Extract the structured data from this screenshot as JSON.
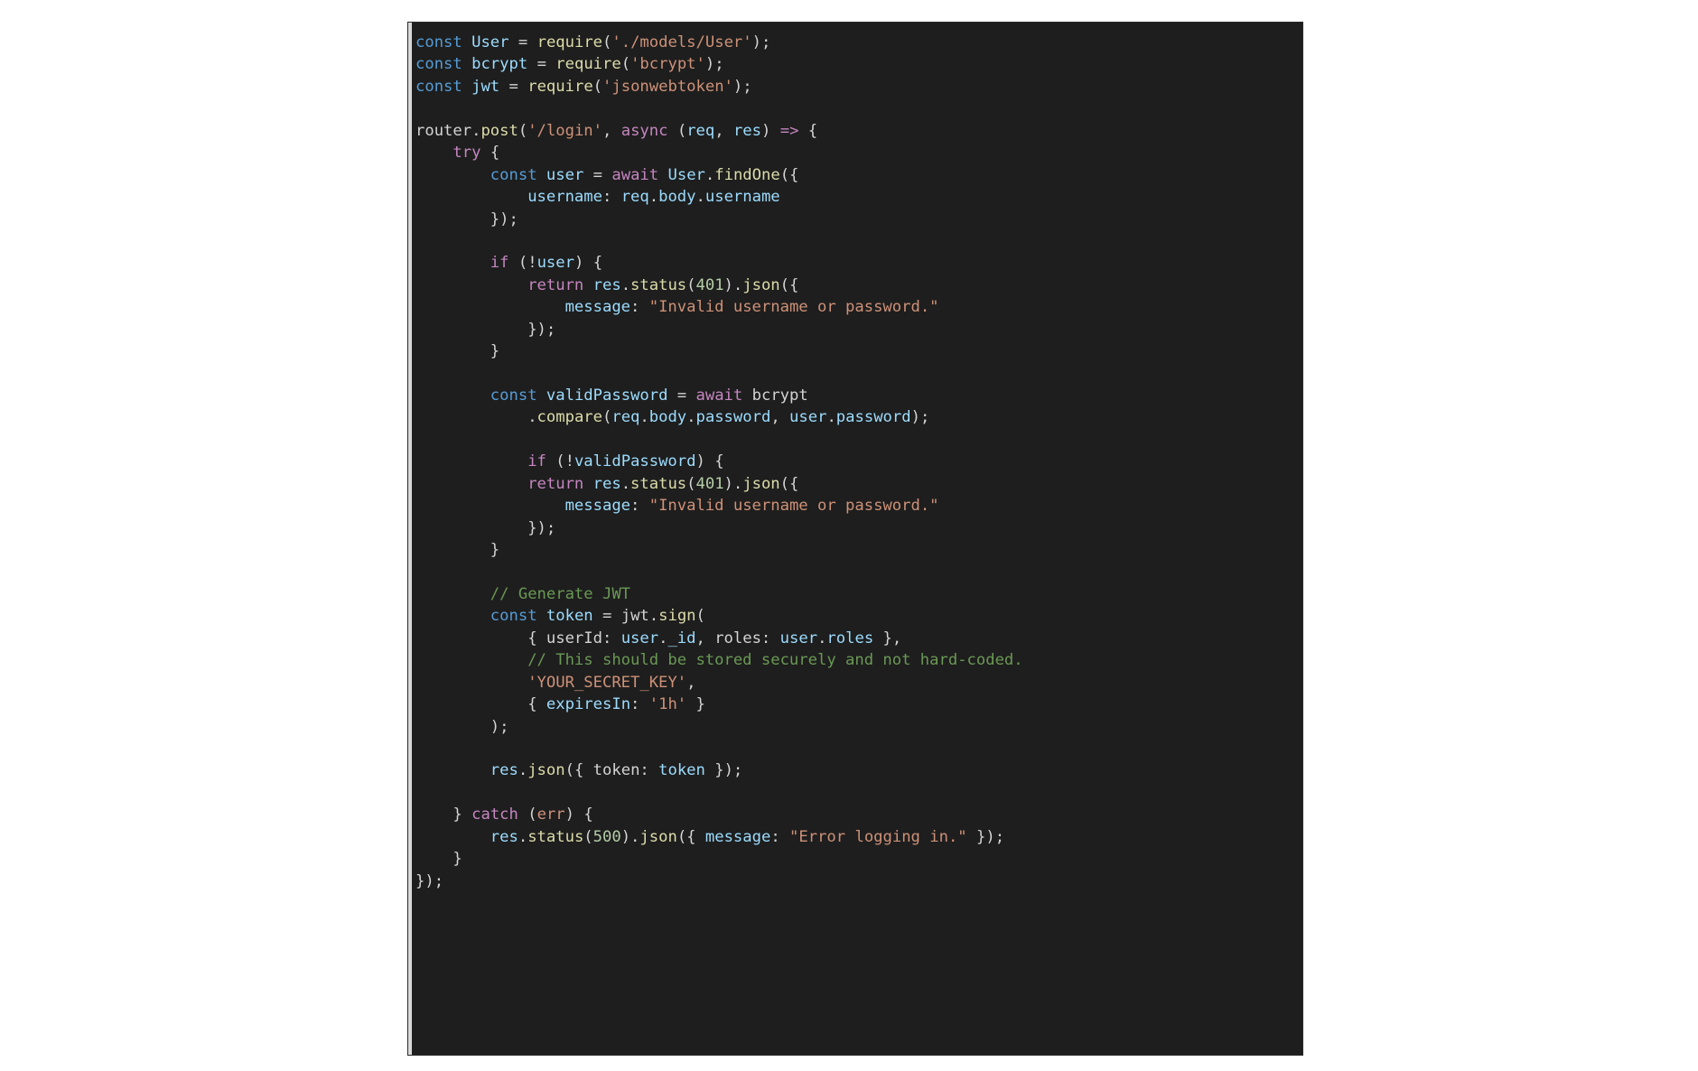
{
  "page": {
    "background_color": "#ffffff",
    "code_block_background": "#1e1e1e",
    "gutter_color": "#d9d9d9"
  },
  "theme": {
    "name": "dark-plus",
    "colors": {
      "keyword": "#569cd6",
      "control": "#c586c0",
      "variable": "#9cdcfe",
      "function": "#dcdcaa",
      "string": "#ce9178",
      "number": "#b5cea8",
      "comment": "#6a9955",
      "class": "#4ec9b0",
      "plain": "#d4d4d4"
    }
  },
  "code": {
    "language": "javascript",
    "line_count": 47,
    "plain_text": "const User = require('./models/User');\nconst bcrypt = require('bcrypt');\nconst jwt = require('jsonwebtoken');\n\nrouter.post('/login', async (req, res) => {\n    try {\n        const user = await User.findOne({\n            username: req.body.username\n        });\n\n        if (!user) {\n            return res.status(401).json({\n                message: \"Invalid username or password.\"\n            });\n        }\n\n        const validPassword = await bcrypt\n            .compare(req.body.password, user.password);\n\n            if (!validPassword) {\n            return res.status(401).json({\n                message: \"Invalid username or password.\"\n            });\n        }\n\n        // Generate JWT\n        const token = jwt.sign(\n            { userId: user._id, roles: user.roles },\n            // This should be stored securely and not hard-coded.\n            'YOUR_SECRET_KEY',\n            { expiresIn: '1h' }\n        );\n\n        res.json({ token: token });\n\n    } catch (err) {\n        res.status(500).json({ message: \"Error logging in.\" });\n    }\n});",
    "lines": [
      "const User = require('./models/User');",
      "const bcrypt = require('bcrypt');",
      "const jwt = require('jsonwebtoken');",
      "",
      "router.post('/login', async (req, res) => {",
      "    try {",
      "        const user = await User.findOne({",
      "            username: req.body.username",
      "        });",
      "",
      "        if (!user) {",
      "            return res.status(401).json({",
      "                message: \"Invalid username or password.\"",
      "            });",
      "        }",
      "",
      "        const validPassword = await bcrypt",
      "            .compare(req.body.password, user.password);",
      "",
      "            if (!validPassword) {",
      "            return res.status(401).json({",
      "                message: \"Invalid username or password.\"",
      "            });",
      "        }",
      "",
      "        // Generate JWT",
      "        const token = jwt.sign(",
      "            { userId: user._id, roles: user.roles },",
      "            // This should be stored securely and not hard-coded.",
      "            'YOUR_SECRET_KEY',",
      "            { expiresIn: '1h' }",
      "        );",
      "",
      "        res.json({ token: token });",
      "",
      "    } catch (err) {",
      "        res.status(500).json({ message: \"Error logging in.\" });",
      "    }",
      "});"
    ],
    "strings": [
      "'./models/User'",
      "'bcrypt'",
      "'jsonwebtoken'",
      "'/login'",
      "\"Invalid username or password.\"",
      "'YOUR_SECRET_KEY'",
      "'1h'",
      "\"Error logging in.\""
    ],
    "comments": [
      "// Generate JWT",
      "// This should be stored securely and not hard-coded."
    ],
    "numbers": [
      "401",
      "500"
    ],
    "route": "/login",
    "status_codes": [
      "401",
      "500"
    ],
    "token_expiry": "1h",
    "secret_placeholder": "YOUR_SECRET_KEY"
  }
}
